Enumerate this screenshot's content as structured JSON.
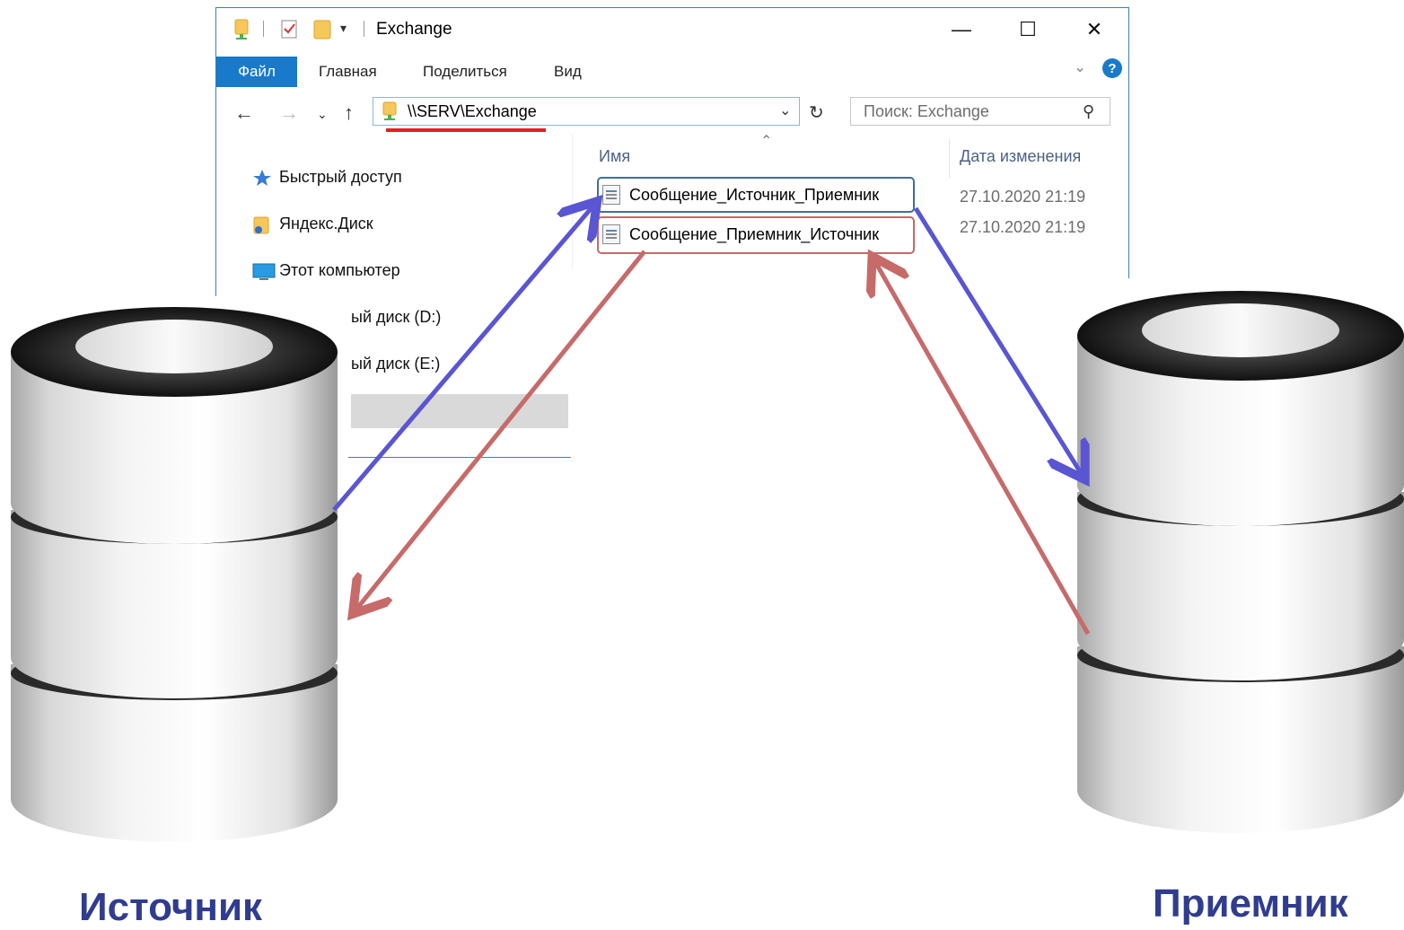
{
  "window": {
    "title": "Exchange",
    "ribbon_tabs": [
      "Файл",
      "Главная",
      "Поделиться",
      "Вид"
    ],
    "address": "\\\\SERV\\Exchange",
    "search_placeholder": "Поиск: Exchange",
    "minimize": "—",
    "maximize": "☐",
    "close": "✕",
    "help": "?"
  },
  "sidebar": {
    "items": [
      {
        "label": "Быстрый доступ",
        "icon": "star-icon"
      },
      {
        "label": "Яндекс.Диск",
        "icon": "folder-icon"
      },
      {
        "label": "Этот компьютер",
        "icon": "computer-icon"
      },
      {
        "label": "ый диск (D:)",
        "icon": ""
      },
      {
        "label": "ый диск (E:)",
        "icon": ""
      }
    ]
  },
  "files": {
    "columns": [
      "Имя",
      "Дата изменения"
    ],
    "rows": [
      {
        "name": "Сообщение_Источник_Приемник",
        "date": "27.10.2020 21:19"
      },
      {
        "name": "Сообщение_Приемник_Источник",
        "date": "27.10.2020 21:19"
      }
    ]
  },
  "diagram": {
    "source_label": "Источник",
    "receiver_label": "Приемник",
    "colors": {
      "arrow_source_to_receiver": "#5a55d2",
      "arrow_receiver_to_source": "#c66a6a",
      "label": "#2f3c8f",
      "address_underline": "#e32020"
    }
  }
}
